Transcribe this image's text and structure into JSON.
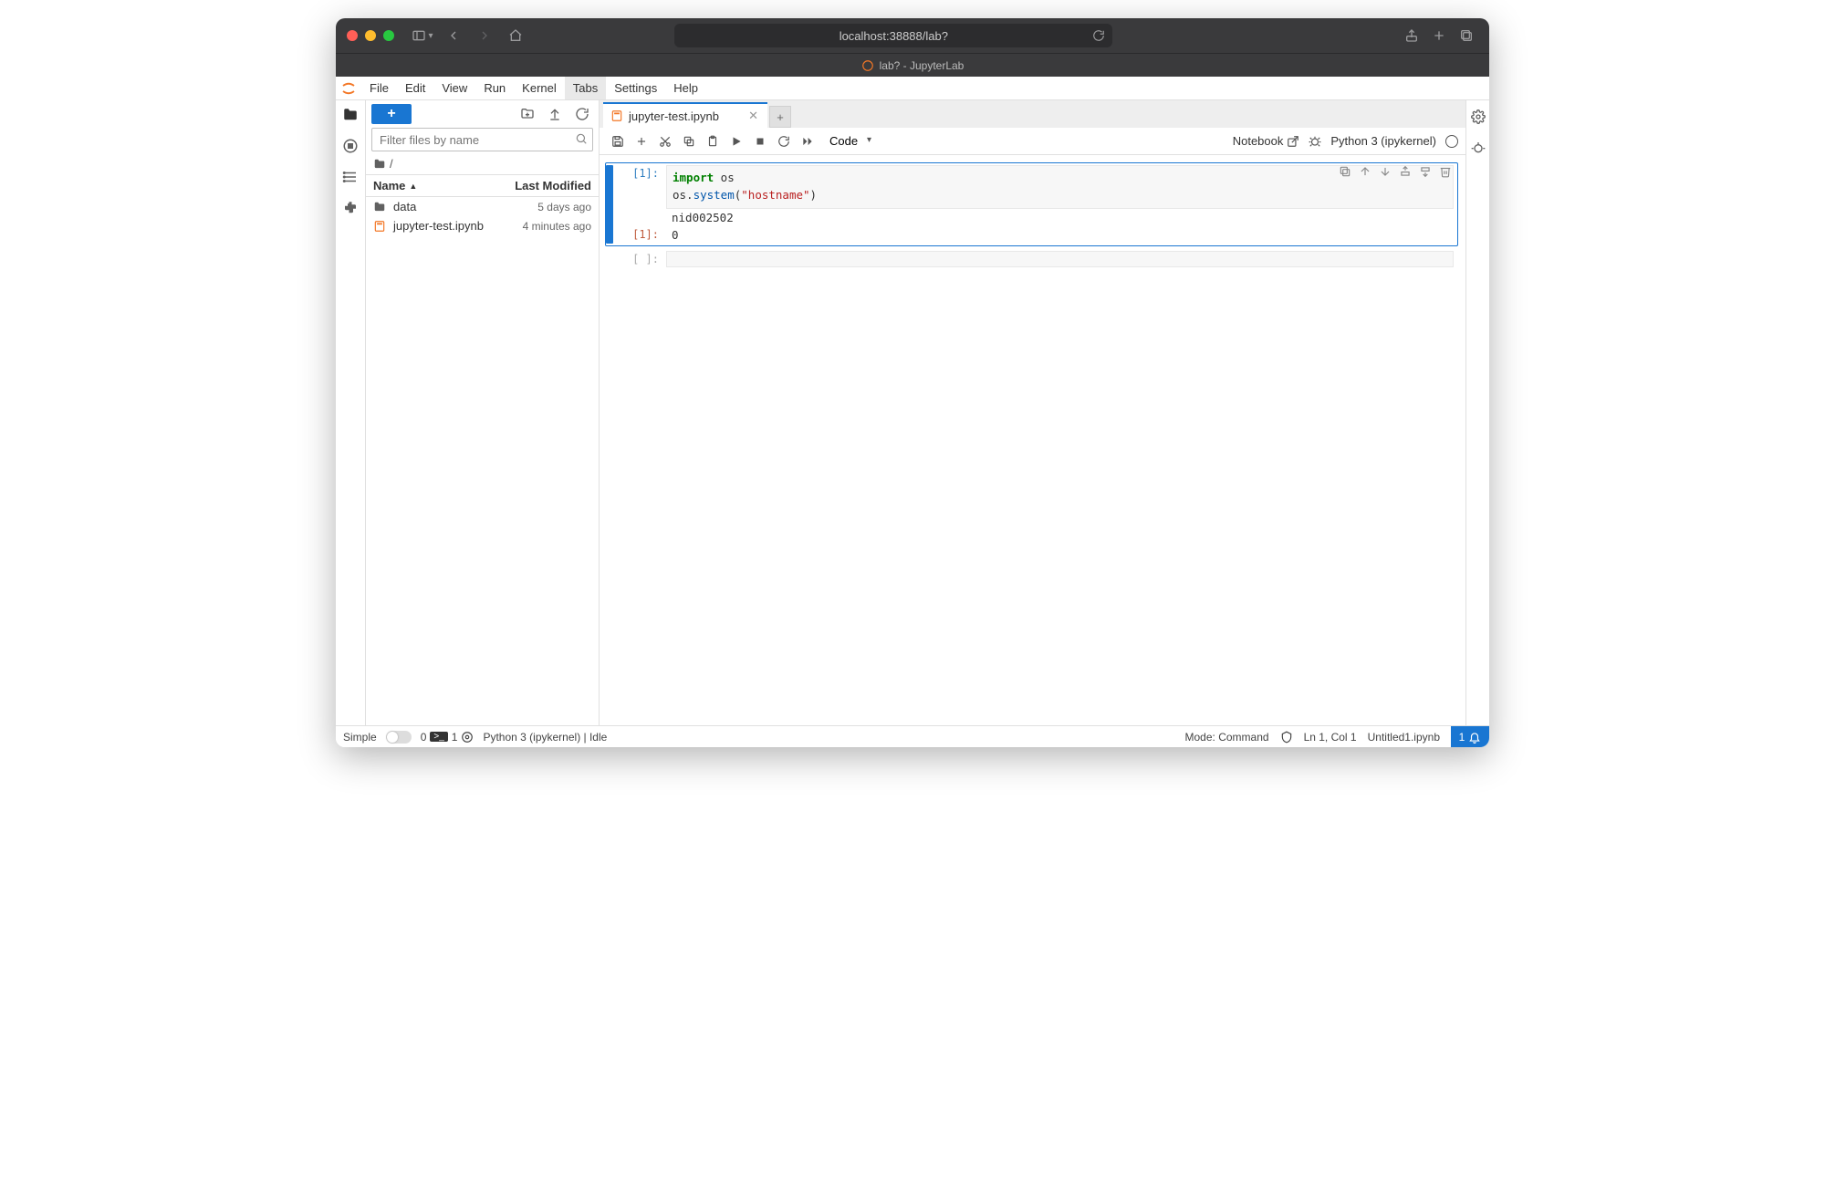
{
  "browser": {
    "url_display": "localhost:38888/lab?",
    "tab_title": "lab? - JupyterLab"
  },
  "menubar": {
    "items": [
      "File",
      "Edit",
      "View",
      "Run",
      "Kernel",
      "Tabs",
      "Settings",
      "Help"
    ],
    "active_index": 5
  },
  "filebrowser": {
    "filter_placeholder": "Filter files by name",
    "breadcrumb_root": "/",
    "header_name": "Name",
    "header_modified": "Last Modified",
    "rows": [
      {
        "icon": "folder",
        "name": "data",
        "modified": "5 days ago"
      },
      {
        "icon": "notebook",
        "name": "jupyter-test.ipynb",
        "modified": "4 minutes ago"
      }
    ]
  },
  "tab": {
    "title": "jupyter-test.ipynb"
  },
  "nbtoolbar": {
    "cell_type": "Code",
    "trusted_label": "Notebook",
    "kernel_label": "Python 3 (ipykernel)"
  },
  "cells": {
    "c0_prompt": "[1]:",
    "c0_code_html": "<span class='kw'>import</span> os\nos.<span class='fn'>system</span>(<span class='str'>\"hostname\"</span>)",
    "c0_stdout": "nid002502",
    "c0_out_prompt": "[1]:",
    "c0_out_value": "0",
    "c1_prompt": "[ ]:"
  },
  "statusbar": {
    "simple_label": "Simple",
    "kernels_running": "0",
    "terminals_running": "1",
    "kernel_status": "Python 3 (ipykernel) | Idle",
    "mode": "Mode: Command",
    "cursor": "Ln 1, Col 1",
    "filename": "Untitled1.ipynb",
    "notifications": "1"
  }
}
